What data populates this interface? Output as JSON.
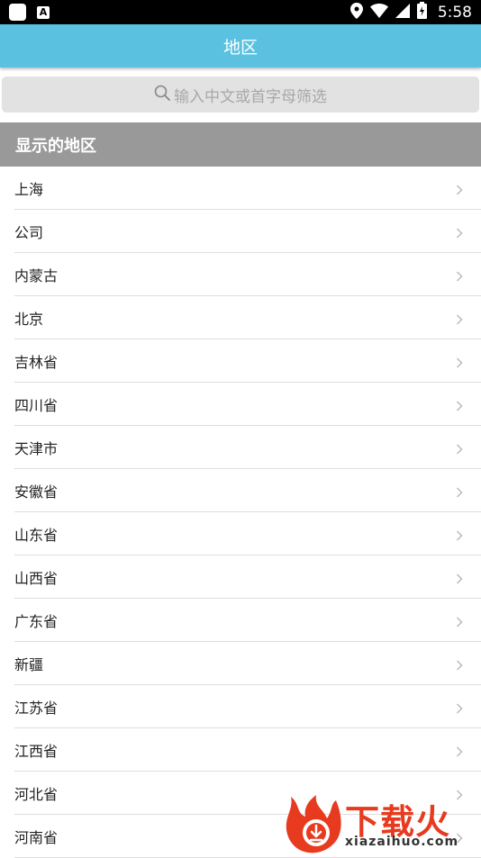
{
  "status_bar": {
    "time": "5:58",
    "app_icon_glyph": "A",
    "icons": [
      "notification-app-icon",
      "android-a-icon",
      "location-icon",
      "wifi-icon",
      "cell-signal-icon",
      "battery-icon"
    ]
  },
  "header": {
    "title": "地区"
  },
  "search": {
    "placeholder": "输入中文或首字母筛选",
    "icon": "search-icon"
  },
  "section": {
    "title": "显示的地区"
  },
  "regions": [
    "上海",
    "公司",
    "内蒙古",
    "北京",
    "吉林省",
    "四川省",
    "天津市",
    "安徽省",
    "山东省",
    "山西省",
    "广东省",
    "新疆",
    "江苏省",
    "江西省",
    "河北省",
    "河南省"
  ],
  "watermark": {
    "brand": "下载火",
    "url": "xiazaihuo.com"
  },
  "colors": {
    "header_bg": "#5bc1e0",
    "section_bg": "#999999",
    "search_bg": "#e2e2e2",
    "watermark": "#e73a1e"
  }
}
